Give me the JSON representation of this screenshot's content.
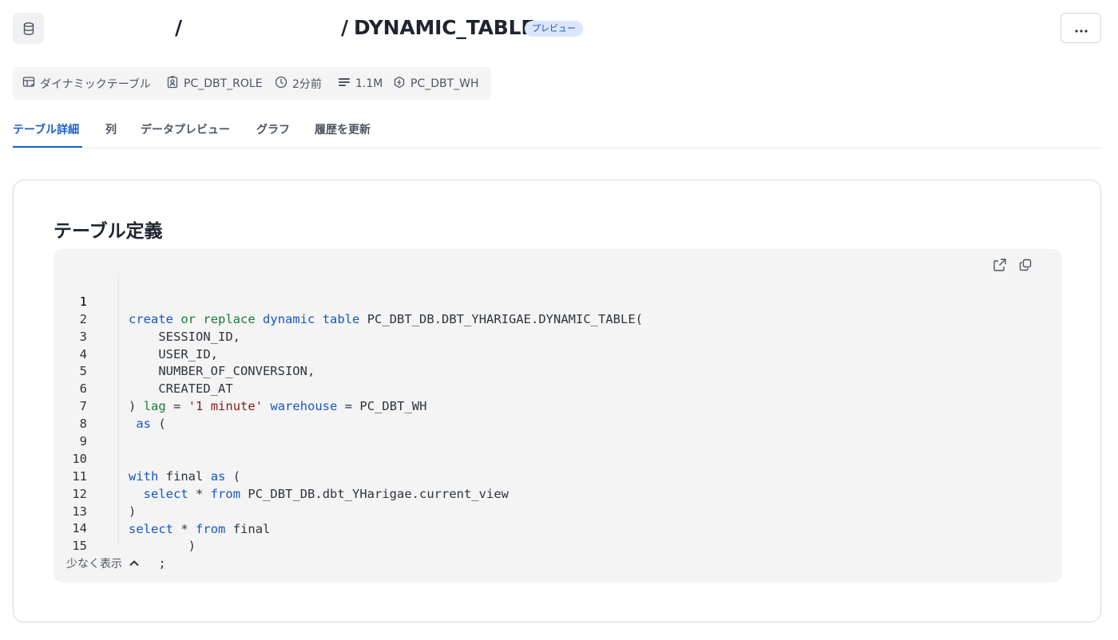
{
  "header": {
    "title": "DYNAMIC_TABLE",
    "separator": "/",
    "badge": "プレビュー"
  },
  "meta": {
    "type": "ダイナミックテーブル",
    "role": "PC_DBT_ROLE",
    "updated": "2分前",
    "rows": "1.1M",
    "warehouse": "PC_DBT_WH"
  },
  "tabs": [
    {
      "label": "テーブル詳細",
      "active": true
    },
    {
      "label": "列"
    },
    {
      "label": "データプレビュー"
    },
    {
      "label": "グラフ"
    },
    {
      "label": "履歴を更新"
    }
  ],
  "card": {
    "title": "テーブル定義",
    "show_less": "少なく表示"
  },
  "code": {
    "line_numbers": [
      "1",
      "2",
      "3",
      "4",
      "5",
      "6",
      "7",
      "8",
      "9",
      "10",
      "11",
      "12",
      "13",
      "14",
      "15"
    ],
    "tokens": {
      "create": "create",
      "or": "or",
      "replace": "replace",
      "dynamic": "dynamic",
      "table": "table",
      "table_name": "PC_DBT_DB.DBT_YHARIGAE.DYNAMIC_TABLE(",
      "col1": "SESSION_ID,",
      "col2": "USER_ID,",
      "col3": "NUMBER_OF_CONVERSION,",
      "col4": "CREATED_AT",
      "close_paren": ")",
      "lag": "lag",
      "equals": "=",
      "lag_value": "'1 minute'",
      "warehouse_kw": "warehouse",
      "warehouse_value": "PC_DBT_WH",
      "as": "as",
      "open_paren": "(",
      "with": "with",
      "final": "final",
      "select": "select",
      "star": "*",
      "from": "from",
      "source": "PC_DBT_DB.dbt_YHarigae.current_view",
      "semicolon": ";"
    }
  },
  "colors": {
    "accent": "#1a5fd0",
    "keyword": "#1656c4",
    "keyword_alt": "#1b7a3c",
    "string": "#8a1a14",
    "badge_bg": "#dbe6fb"
  },
  "icons": {
    "database": "database-icon",
    "more": "more-horizontal-icon",
    "table_type": "dynamic-table-icon",
    "role": "role-badge-icon",
    "clock": "clock-icon",
    "rows": "rows-icon",
    "warehouse": "warehouse-icon",
    "open_external": "open-external-icon",
    "copy": "copy-icon",
    "chevron_up": "chevron-up-icon"
  }
}
